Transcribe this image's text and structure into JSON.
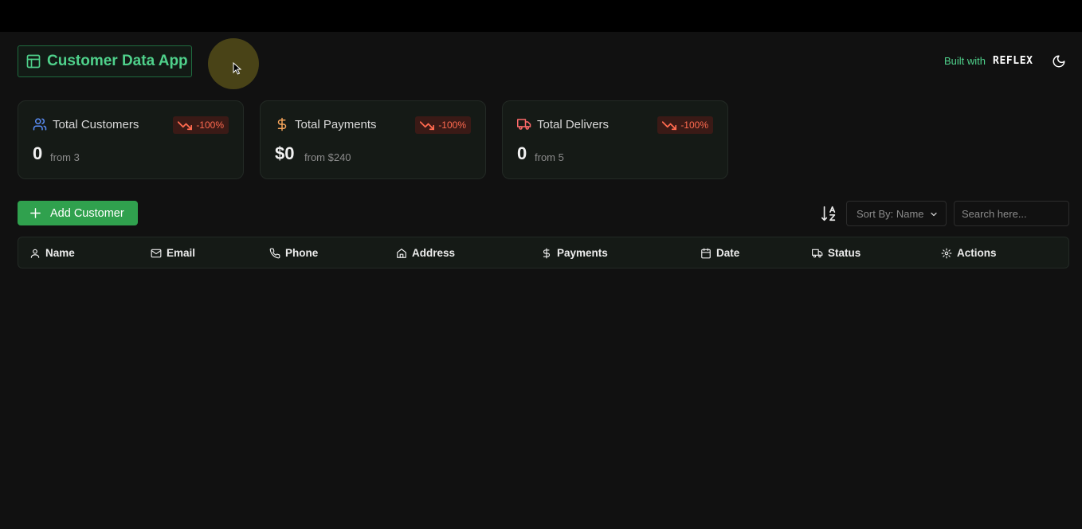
{
  "app": {
    "title": "Customer Data App"
  },
  "header": {
    "built_with": "Built with",
    "brand": "REFLEX"
  },
  "stats": [
    {
      "label": "Total Customers",
      "change": "-100%",
      "value": "0",
      "from": "from 3",
      "icon": "users-icon",
      "icon_color": "#5b8ff9"
    },
    {
      "label": "Total Payments",
      "change": "-100%",
      "value": "$0",
      "from": "from $240",
      "icon": "dollar-icon",
      "icon_color": "#f5a45b"
    },
    {
      "label": "Total Delivers",
      "change": "-100%",
      "value": "0",
      "from": "from 5",
      "icon": "truck-icon",
      "icon_color": "#ff6a6a"
    }
  ],
  "toolbar": {
    "add_label": "Add Customer",
    "sort_label": "Sort By: Name",
    "search_placeholder": "Search here..."
  },
  "table": {
    "columns": [
      {
        "label": "Name",
        "icon": "user-icon"
      },
      {
        "label": "Email",
        "icon": "mail-icon"
      },
      {
        "label": "Phone",
        "icon": "phone-icon"
      },
      {
        "label": "Address",
        "icon": "home-icon"
      },
      {
        "label": "Payments",
        "icon": "dollar-icon"
      },
      {
        "label": "Date",
        "icon": "calendar-icon"
      },
      {
        "label": "Status",
        "icon": "truck-icon"
      },
      {
        "label": "Actions",
        "icon": "gear-icon"
      }
    ],
    "rows": []
  },
  "colors": {
    "accent": "#4fd18b",
    "button": "#30a14e",
    "negative": "#ff6a4f",
    "background": "#111111"
  }
}
